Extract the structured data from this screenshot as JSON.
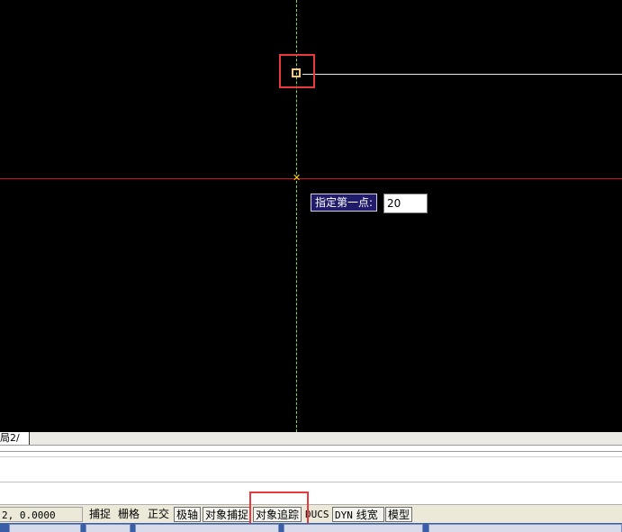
{
  "drawing": {
    "dyn_prompt_label": "指定第一点:",
    "dyn_input_value": "20"
  },
  "layout_tabs": {
    "active_tab": "局2"
  },
  "status_bar": {
    "coords": "2, 0.0000",
    "buttons": {
      "snap": "捕捉",
      "grid": "栅格",
      "ortho": "正交",
      "polar": "极轴",
      "osnap": "对象捕捉",
      "otrack": "对象追踪",
      "ducs": "DUCS",
      "dyn": "DYN",
      "lwt": "线宽",
      "model": "模型"
    }
  },
  "colors": {
    "canvas": "#000000",
    "crosshair_vertical": "#7ddc3c",
    "crosshair_horizontal": "#c81616",
    "highlight_box": "#e8393d",
    "snap_marker": "#f1c98a",
    "dyn_prompt_bg": "#201c6a"
  }
}
